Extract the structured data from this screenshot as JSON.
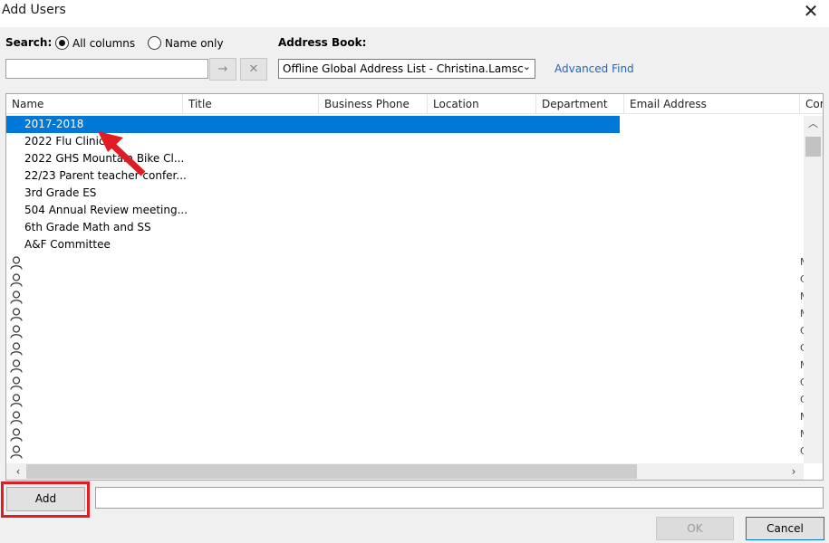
{
  "window": {
    "title": "Add Users"
  },
  "search": {
    "label": "Search:",
    "options": [
      {
        "label": "All columns",
        "selected": true
      },
      {
        "label": "Name only",
        "selected": false
      }
    ],
    "value": "",
    "go_icon": "→",
    "clear_icon": "✕"
  },
  "address_book": {
    "label": "Address Book:",
    "value": "Offline Global Address List - Christina.Lamsc",
    "advanced_find": "Advanced Find"
  },
  "table": {
    "columns": [
      "Name",
      "Title",
      "Business Phone",
      "Location",
      "Department",
      "Email Address",
      "Cor"
    ],
    "rows": [
      {
        "name": "2017-2018",
        "icon": "",
        "extra": ""
      },
      {
        "name": "2022 Flu Clinic",
        "icon": "",
        "extra": ""
      },
      {
        "name": "2022 GHS Mountain Bike Cl...",
        "icon": "",
        "extra": ""
      },
      {
        "name": "22/23 Parent teacher confer...",
        "icon": "",
        "extra": ""
      },
      {
        "name": "3rd Grade ES",
        "icon": "",
        "extra": ""
      },
      {
        "name": "504 Annual Review meeting...",
        "icon": "",
        "extra": ""
      },
      {
        "name": "6th Grade Math and SS",
        "icon": "",
        "extra": ""
      },
      {
        "name": "A&F Committee",
        "icon": "",
        "extra": ""
      },
      {
        "name": "",
        "icon": "person-icon",
        "extra": "M"
      },
      {
        "name": "",
        "icon": "person-icon",
        "extra": "C"
      },
      {
        "name": "",
        "icon": "person-icon",
        "extra": "M"
      },
      {
        "name": "",
        "icon": "person-icon",
        "extra": "M"
      },
      {
        "name": "",
        "icon": "person-icon",
        "extra": "C"
      },
      {
        "name": "",
        "icon": "person-icon",
        "extra": "C"
      },
      {
        "name": "",
        "icon": "person-icon",
        "extra": "M"
      },
      {
        "name": "",
        "icon": "person-icon",
        "extra": "C"
      },
      {
        "name": "",
        "icon": "person-icon",
        "extra": "C"
      },
      {
        "name": "",
        "icon": "person-icon",
        "extra": "M"
      },
      {
        "name": "",
        "icon": "person-icon",
        "extra": "M"
      },
      {
        "name": "",
        "icon": "person-icon",
        "extra": "C"
      }
    ],
    "selected_index": 0
  },
  "add_button": {
    "label": "Add"
  },
  "add_field": {
    "value": ""
  },
  "ok_button": {
    "label": "OK"
  },
  "cancel_button": {
    "label": "Cancel"
  },
  "colors": {
    "selection": "#0078d7",
    "highlight_box": "#e11b22",
    "link": "#1f66c2"
  }
}
